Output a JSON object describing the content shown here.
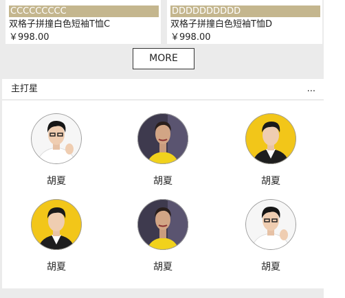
{
  "products": [
    {
      "tag": "CCCCCCCCC",
      "title": "双格子拼撞白色短袖T恤C",
      "price": "￥998.00"
    },
    {
      "tag": "DDDDDDDDDD",
      "title": "双格子拼撞白色短袖T恤D",
      "price": "￥998.00"
    }
  ],
  "more_button_label": "MORE",
  "stars_section": {
    "title": "主打星",
    "more_icon": "...",
    "items": [
      {
        "name": "胡夏",
        "avatar_style": "white"
      },
      {
        "name": "胡夏",
        "avatar_style": "dark"
      },
      {
        "name": "胡夏",
        "avatar_style": "yellow"
      },
      {
        "name": "胡夏",
        "avatar_style": "yellow"
      },
      {
        "name": "胡夏",
        "avatar_style": "dark"
      },
      {
        "name": "胡夏",
        "avatar_style": "white"
      }
    ]
  },
  "colors": {
    "tag_bg": "#c4b68e",
    "page_bg": "#ebebeb",
    "avatar_yellow": "#f2c619",
    "avatar_dark": "#3e3a4e"
  }
}
